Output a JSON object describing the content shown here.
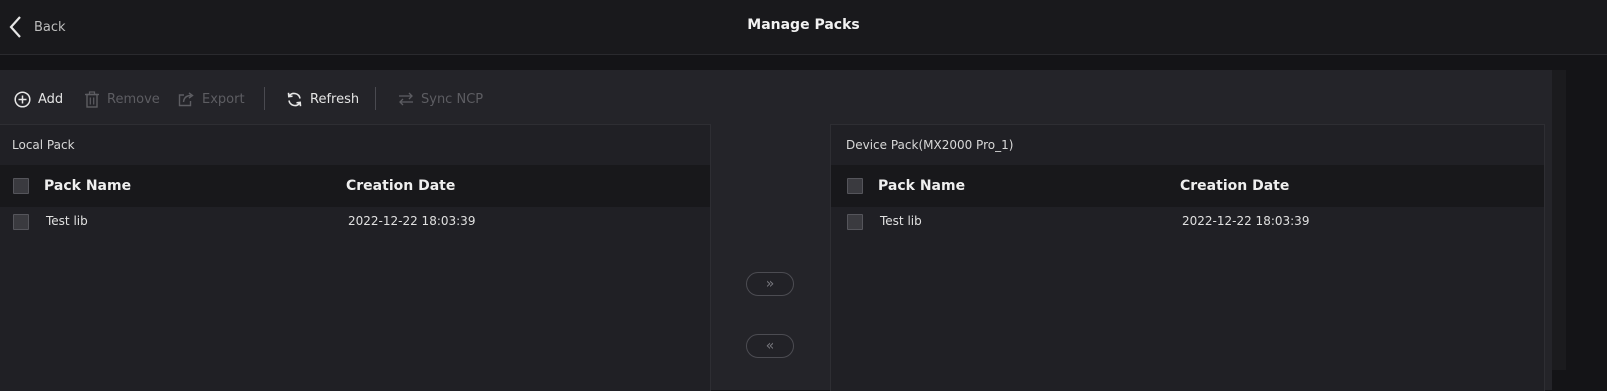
{
  "header": {
    "back_label": "Back",
    "title": "Manage Packs"
  },
  "toolbar": {
    "add_label": "Add",
    "remove_label": "Remove",
    "export_label": "Export",
    "refresh_label": "Refresh",
    "sync_label": "Sync NCP"
  },
  "local_pack": {
    "title": "Local Pack",
    "columns": [
      "Pack Name",
      "Creation Date"
    ],
    "rows": [
      {
        "name": "Test lib",
        "date": "2022-12-22 18:03:39"
      }
    ]
  },
  "device_pack": {
    "title": "Device Pack(MX2000 Pro_1)",
    "columns": [
      "Pack Name",
      "Creation Date"
    ],
    "rows": [
      {
        "name": "Test lib",
        "date": "2022-12-22 18:03:39"
      }
    ]
  },
  "transfer": {
    "to_device_glyph": "»",
    "to_local_glyph": "«"
  },
  "colors": {
    "background": "#141417",
    "panel": "#202025",
    "header_row": "#18181b",
    "disabled_text": "#5d5d62"
  }
}
